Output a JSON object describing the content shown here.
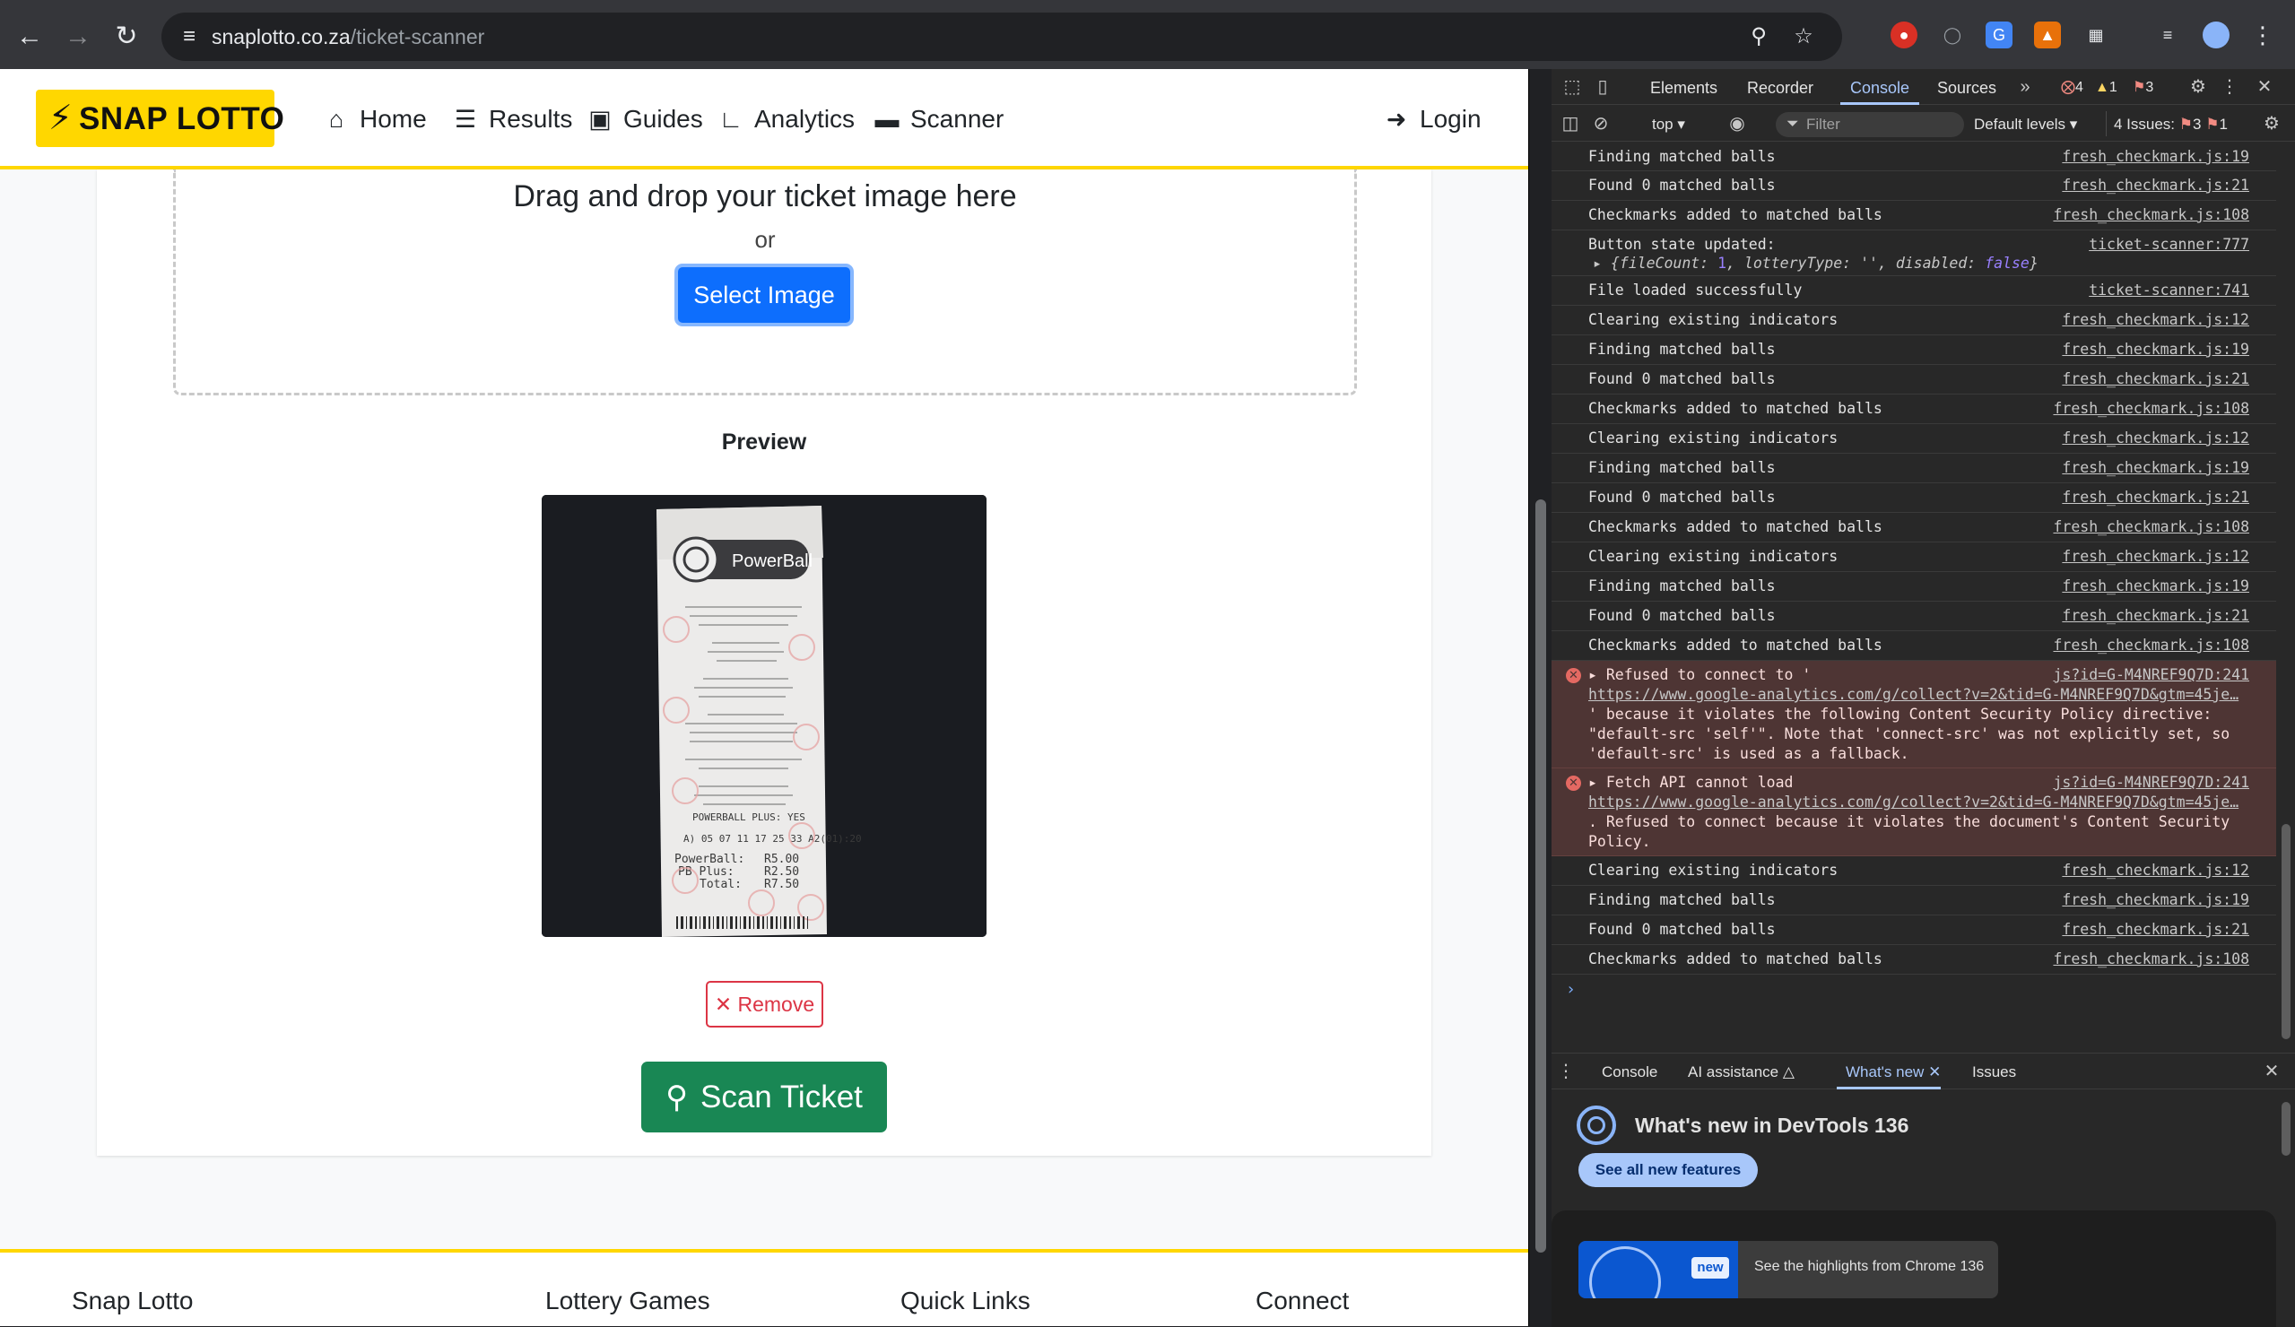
{
  "browser": {
    "url_host": "snaplotto.co.za",
    "url_path": "/ticket-scanner",
    "back_icon": "arrow-left-icon",
    "forward_icon": "arrow-right-icon",
    "reload_icon": "reload-icon"
  },
  "site": {
    "logo_text": "SNAP LOTTO",
    "nav": [
      {
        "label": "Home",
        "icon": "home-icon"
      },
      {
        "label": "Results",
        "icon": "list-icon"
      },
      {
        "label": "Guides",
        "icon": "book-icon"
      },
      {
        "label": "Analytics",
        "icon": "chart-icon"
      },
      {
        "label": "Scanner",
        "icon": "ticket-icon"
      }
    ],
    "login_label": "Login"
  },
  "uploader": {
    "drag_text": "Drag and drop your ticket image here",
    "or_text": "or",
    "select_label": "Select Image",
    "preview_heading": "Preview",
    "remove_label": "Remove",
    "scan_label": "Scan Ticket"
  },
  "ticket_image": {
    "brand": "PowerBall",
    "line_play": "POWERBALL PLUS: YES",
    "board": "A) 05 07 11 17 25 33 A2(01):20",
    "powerball_label": "PowerBall:",
    "powerball_amount": "R5.00",
    "pbplus_label": "PB Plus:",
    "pbplus_amount": "R2.50",
    "total_label": "Total:",
    "total_amount": "R7.50"
  },
  "footer": {
    "columns": [
      "Snap Lotto",
      "Lottery Games",
      "Quick Links",
      "Connect"
    ]
  },
  "devtools": {
    "tabs": [
      "Elements",
      "Recorder",
      "Console",
      "Sources"
    ],
    "active_tab": "Console",
    "error_count": "4",
    "warning_count": "1",
    "issue_count": "3",
    "context": "top",
    "filter_placeholder": "Filter",
    "levels": "Default levels",
    "issues_label": "4 Issues:",
    "issues_err": "3",
    "issues_info": "1",
    "console_lines": [
      {
        "msg": "Finding matched balls",
        "src": "fresh_checkmark.js:19"
      },
      {
        "msg": "Found 0 matched balls",
        "src": "fresh_checkmark.js:21"
      },
      {
        "msg": "Checkmarks added to matched balls",
        "src": "fresh_checkmark.js:108"
      },
      {
        "msg": "Button state updated:",
        "src": "ticket-scanner:777"
      },
      {
        "msg": "File loaded successfully",
        "src": "ticket-scanner:741"
      },
      {
        "msg": "Clearing existing indicators",
        "src": "fresh_checkmark.js:12"
      },
      {
        "msg": "Finding matched balls",
        "src": "fresh_checkmark.js:19"
      },
      {
        "msg": "Found 0 matched balls",
        "src": "fresh_checkmark.js:21"
      },
      {
        "msg": "Checkmarks added to matched balls",
        "src": "fresh_checkmark.js:108"
      },
      {
        "msg": "Clearing existing indicators",
        "src": "fresh_checkmark.js:12"
      },
      {
        "msg": "Finding matched balls",
        "src": "fresh_checkmark.js:19"
      },
      {
        "msg": "Found 0 matched balls",
        "src": "fresh_checkmark.js:21"
      },
      {
        "msg": "Checkmarks added to matched balls",
        "src": "fresh_checkmark.js:108"
      },
      {
        "msg": "Clearing existing indicators",
        "src": "fresh_checkmark.js:12"
      },
      {
        "msg": "Finding matched balls",
        "src": "fresh_checkmark.js:19"
      },
      {
        "msg": "Found 0 matched balls",
        "src": "fresh_checkmark.js:21"
      },
      {
        "msg": "Checkmarks added to matched balls",
        "src": "fresh_checkmark.js:108"
      },
      {
        "msg": "Clearing existing indicators",
        "src": "fresh_checkmark.js:12"
      },
      {
        "msg": "Finding matched balls",
        "src": "fresh_checkmark.js:19"
      },
      {
        "msg": "Found 0 matched balls",
        "src": "fresh_checkmark.js:21"
      },
      {
        "msg": "Checkmarks added to matched balls",
        "src": "fresh_checkmark.js:108"
      }
    ],
    "button_state_obj": {
      "fileCount_key": "fileCount:",
      "fileCount_val": "1",
      "lotteryType_key": "lotteryType:",
      "lotteryType_val": "''",
      "disabled_key": "disabled:",
      "disabled_val": "false"
    },
    "errors": [
      {
        "head": "Refused to connect to '",
        "src": "js?id=G-M4NREF9Q7D:241",
        "link": "https://www.google-analytics.com/g/collect?v=2&tid=G-M4NREF9Q7D&gtm=45je…",
        "body1": "' because it violates the following Content Security Policy directive:",
        "body2": "\"default-src 'self'\". Note that 'connect-src' was not explicitly set, so",
        "body3": "'default-src' is used as a fallback."
      },
      {
        "head": "Fetch API cannot load",
        "src": "js?id=G-M4NREF9Q7D:241",
        "link": "https://www.google-analytics.com/g/collect?v=2&tid=G-M4NREF9Q7D&gtm=45je…",
        "body1": ". Refused to connect because it violates the document's Content Security",
        "body2": "Policy."
      }
    ],
    "drawer_tabs": [
      "Console",
      "AI assistance",
      "What's new",
      "Issues"
    ],
    "whats_new_title": "What's new in DevTools 136",
    "see_all_label": "See all new features",
    "new_badge": "new",
    "highlight_text": "See the highlights from Chrome 136"
  }
}
